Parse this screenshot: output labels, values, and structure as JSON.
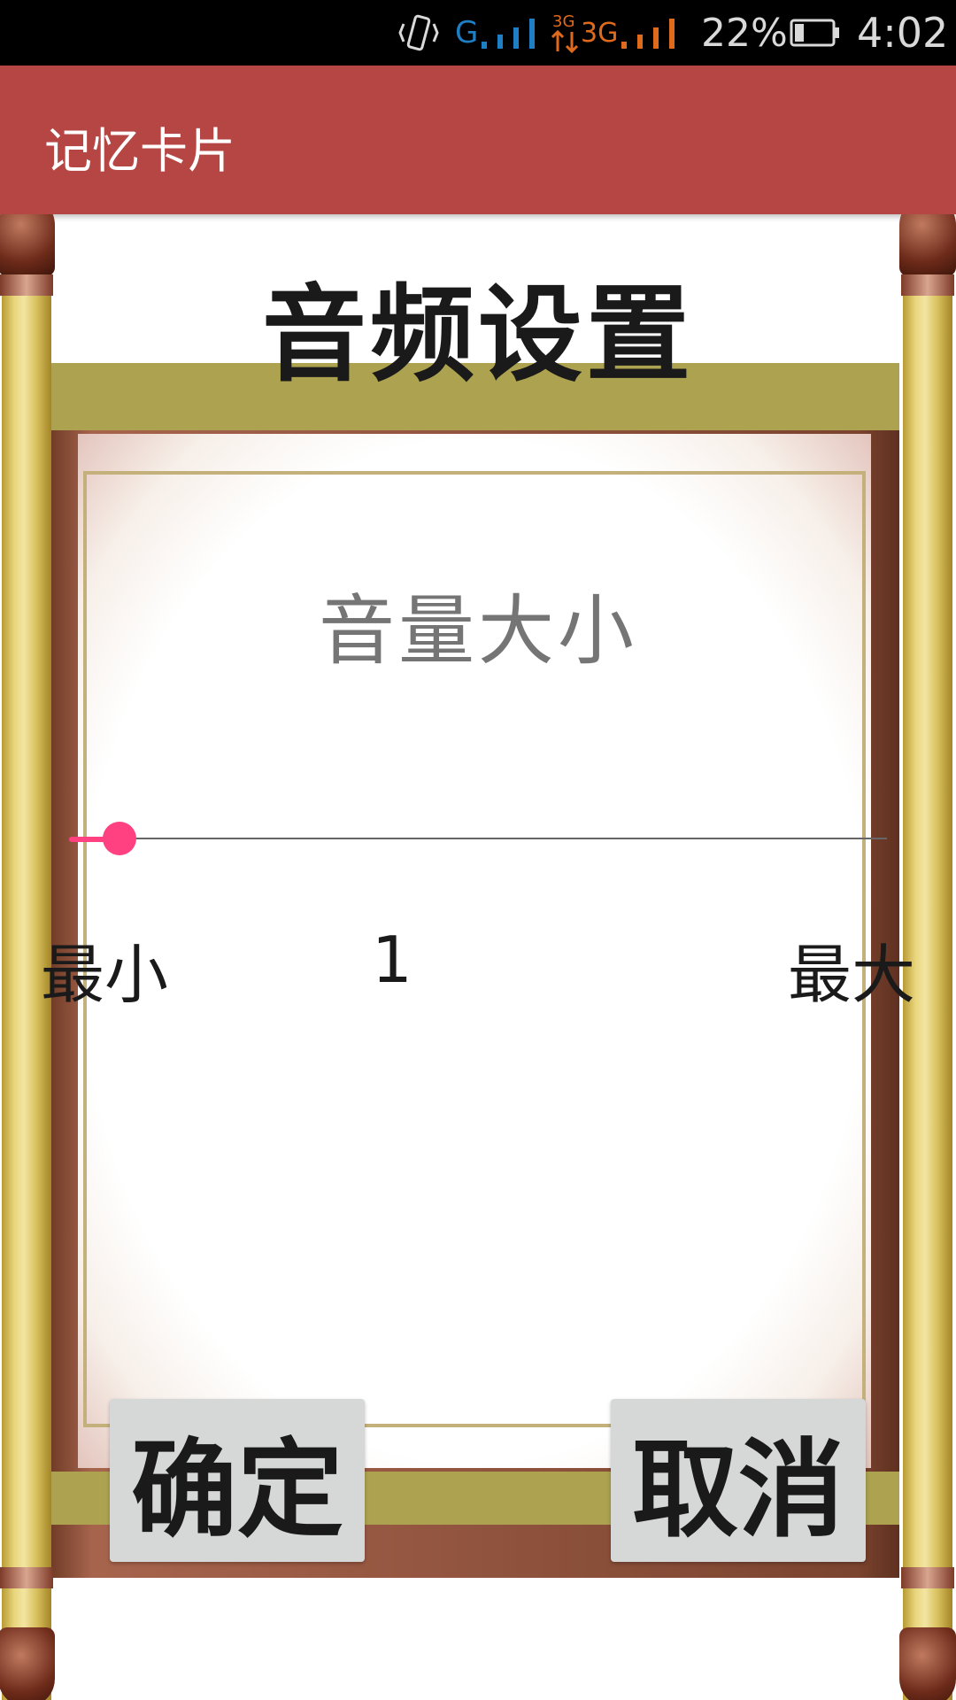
{
  "status_bar": {
    "network_1": "G",
    "network_2": "3G",
    "battery": "22%",
    "time": "4:02"
  },
  "app_bar": {
    "title": "记忆卡片"
  },
  "screen": {
    "heading": "音频设置",
    "volume_label": "音量大小",
    "slider": {
      "value": 1,
      "fraction": 0.06
    },
    "min_label": "最小",
    "value_text": "1",
    "max_label": "最大",
    "confirm_label": "确定",
    "cancel_label": "取消"
  },
  "colors": {
    "status_bar": "#000000",
    "app_bar": "#b54643",
    "slider_accent": "#ff4081",
    "button_bg": "#d6d7d7"
  }
}
